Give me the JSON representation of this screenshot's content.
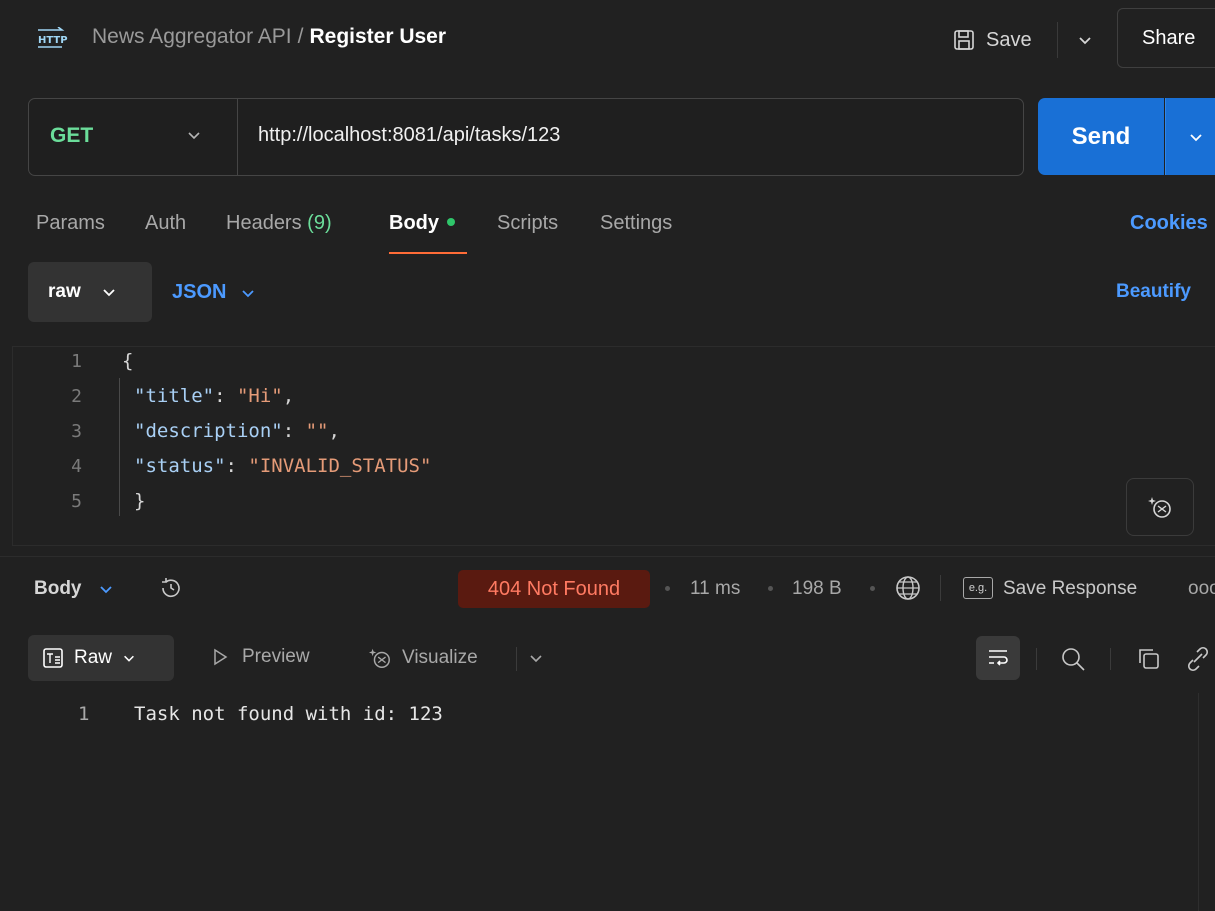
{
  "header": {
    "collection": "News Aggregator API",
    "separator": "/",
    "request_name": "Register User",
    "save_label": "Save",
    "share_label": "Share",
    "http_icon_text": "HTTP"
  },
  "request": {
    "method": "GET",
    "url": "http://localhost:8081/api/tasks/123",
    "send_label": "Send"
  },
  "tabs": {
    "params": "Params",
    "auth": "Auth",
    "headers": "Headers",
    "headers_count": "(9)",
    "body": "Body",
    "scripts": "Scripts",
    "settings": "Settings",
    "cookies": "Cookies"
  },
  "body_options": {
    "mode": "raw",
    "format": "JSON",
    "beautify": "Beautify"
  },
  "editor": {
    "lines": [
      {
        "n": "1",
        "text": "{"
      },
      {
        "n": "2",
        "key": "\"title\"",
        "value": "\"Hi\"",
        "trail": ","
      },
      {
        "n": "3",
        "key": "\"description\"",
        "value": "\"\"",
        "trail": ","
      },
      {
        "n": "4",
        "key": "\"status\"",
        "value": "\"INVALID_STATUS\"",
        "trail": ""
      },
      {
        "n": "5",
        "text": "}"
      }
    ]
  },
  "response": {
    "body_label": "Body",
    "status": "404 Not Found",
    "time": "11 ms",
    "size": "198 B",
    "save_response": "Save Response",
    "more": "ooo",
    "eg_label": "e.g.",
    "view_raw": "Raw",
    "view_preview": "Preview",
    "view_visualize": "Visualize",
    "line_no": "1",
    "text": "Task not found with id: 123"
  },
  "colors": {
    "accent_blue": "#1970d6",
    "method_green": "#6bdd9a",
    "tab_underline": "#ff6c37",
    "status_bg": "#5a1a10",
    "status_text": "#ff7a62"
  }
}
